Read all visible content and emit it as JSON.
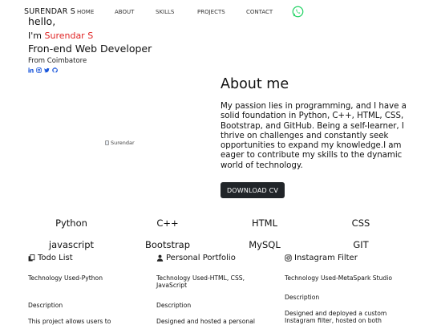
{
  "nav": {
    "brand": "SURENDAR S",
    "links": [
      "HOME",
      "ABOUT",
      "SKILLS",
      "PROJECTS",
      "CONTACT"
    ],
    "whatsapp_icon": "whatsapp-icon",
    "whatsapp_color": "#25D366"
  },
  "hero": {
    "greeting": "hello,",
    "intro_prefix": "I'm ",
    "name": "Surendar S",
    "name_color": "#e02424",
    "role": "Fron-end Web Developer",
    "location": "From Coimbatore",
    "social_icons": [
      "linkedin-icon",
      "instagram-icon",
      "twitter-icon",
      "github-icon"
    ],
    "social_color": "#1a56db"
  },
  "profile_image": {
    "alt": "Surendar"
  },
  "about": {
    "title": "About me",
    "text": "My passion lies in programming, and I have a solid foundation in Python, C++, HTML, CSS, Bootstrap, and GitHub. Being a self-learner, I thrive on challenges and constantly seek opportunities to expand my knowledge.I am eager to contribute my skills to the dynamic world of technology.",
    "cv_button": "DOWNLOAD CV"
  },
  "skills": [
    "Python",
    "C++",
    "HTML",
    "CSS",
    "javascript",
    "Bootstrap",
    "MySQL",
    "GIT"
  ],
  "projects": [
    {
      "icon": "copy-icon",
      "title": "Todo List",
      "tech": "Technology Used-Python",
      "desc_label": "Description",
      "desc": "This project allows users to"
    },
    {
      "icon": "user-icon",
      "title": "Personal Portfolio",
      "tech": "Technology Used-HTML, CSS, JavaScript",
      "desc_label": "Description",
      "desc": "Designed and hosted a personal"
    },
    {
      "icon": "instagram-icon",
      "title": "Instagram Filter",
      "tech": "Technology Used-MetaSpark Studio",
      "desc_label": "Description",
      "desc": "Designed and deployed a custom Instagram filter, hosted on both"
    }
  ]
}
